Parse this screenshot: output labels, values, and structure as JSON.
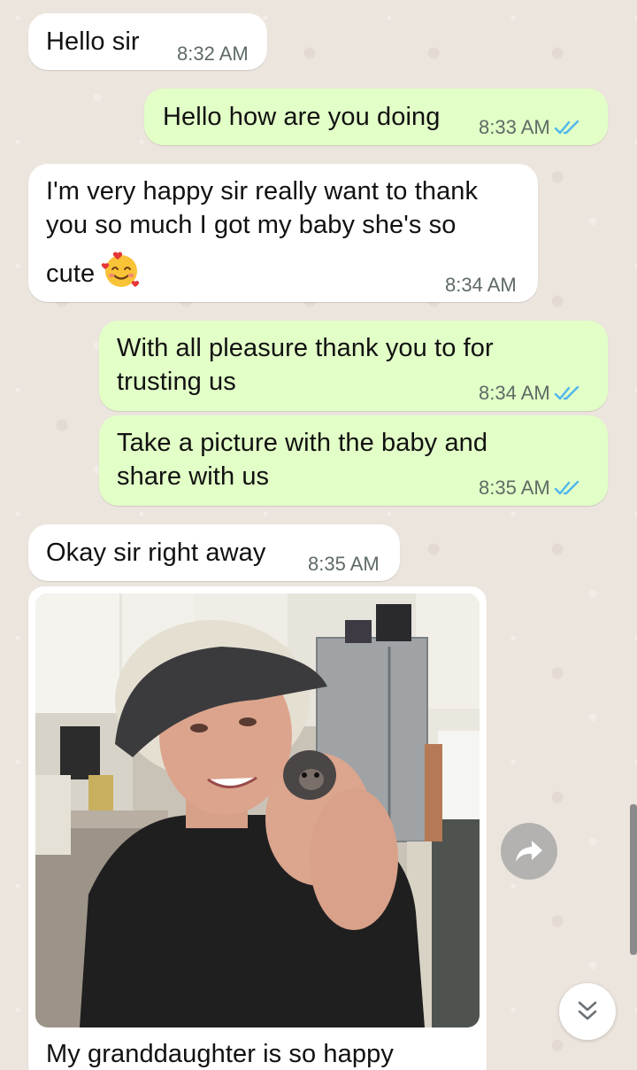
{
  "messages": [
    {
      "direction": "incoming",
      "text": "Hello sir",
      "time": "8:32 AM"
    },
    {
      "direction": "outgoing",
      "text": "Hello how are you doing",
      "time": "8:33 AM",
      "status": "read"
    },
    {
      "direction": "incoming",
      "text_line1": "I'm very happy sir really want to thank",
      "text_line2": "you so much I got my baby she's so",
      "text_line3": "cute",
      "emoji": "smiling-face-with-hearts",
      "time": "8:34 AM"
    },
    {
      "direction": "outgoing",
      "text_line1": "With all pleasure thank you to for",
      "text_line2": "trusting us",
      "time": "8:34 AM",
      "status": "read"
    },
    {
      "direction": "outgoing",
      "text_line1": "Take a picture with the baby and",
      "text_line2": "share with us",
      "time": "8:35 AM",
      "status": "read"
    },
    {
      "direction": "incoming",
      "text": "Okay sir right away",
      "time": "8:35 AM"
    },
    {
      "direction": "incoming",
      "type": "image",
      "caption": "My granddaughter is so happy"
    }
  ],
  "icons": {
    "forward": "forward-arrow-icon",
    "scroll_down": "double-chevron-down-icon",
    "read_receipt": "double-check-icon"
  },
  "colors": {
    "background": "#ece5dd",
    "incoming_bubble": "#ffffff",
    "outgoing_bubble": "#e2ffc7",
    "read_tick": "#4fb6ec",
    "timestamp": "#5f6b66"
  }
}
